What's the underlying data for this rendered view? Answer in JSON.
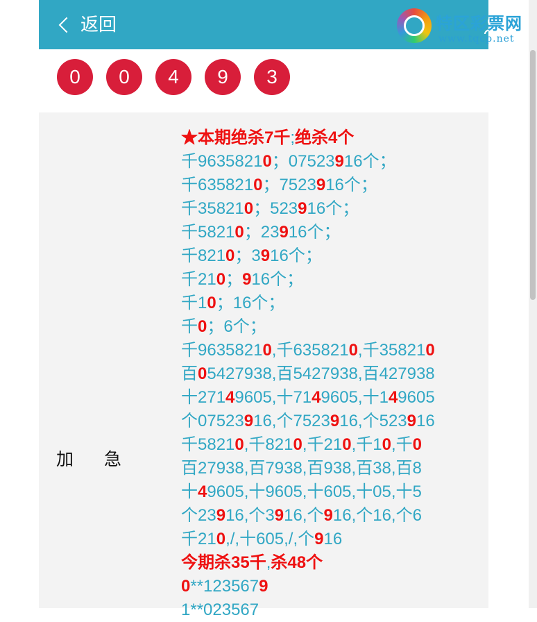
{
  "header": {
    "back_label": "返回",
    "logo_title": "特区彩票网",
    "logo_url": "www.tqcp.net"
  },
  "balls": [
    "0",
    "0",
    "4",
    "9",
    "3"
  ],
  "colors": {
    "header": "#31a7c4",
    "ball": "#d81e3a",
    "highlight": "#ee1111",
    "text": "#31a7c4"
  },
  "panel": {
    "label_1": "加",
    "label_2": "急",
    "lines": [
      [
        [
          "★本期绝杀7千",
          "r"
        ],
        [
          ";",
          ""
        ],
        [
          "绝杀4个",
          "r"
        ]
      ],
      [
        [
          "千9635821",
          ""
        ],
        [
          "0",
          "r"
        ],
        [
          "；07523",
          ""
        ],
        [
          "9",
          "r"
        ],
        [
          "16个；",
          ""
        ]
      ],
      [
        [
          "千635821",
          ""
        ],
        [
          "0",
          "r"
        ],
        [
          "；7523",
          ""
        ],
        [
          "9",
          "r"
        ],
        [
          "16个；",
          ""
        ]
      ],
      [
        [
          "千35821",
          ""
        ],
        [
          "0",
          "r"
        ],
        [
          "；523",
          ""
        ],
        [
          "9",
          "r"
        ],
        [
          "16个；",
          ""
        ]
      ],
      [
        [
          "千5821",
          ""
        ],
        [
          "0",
          "r"
        ],
        [
          "；23",
          ""
        ],
        [
          "9",
          "r"
        ],
        [
          "16个；",
          ""
        ]
      ],
      [
        [
          "千821",
          ""
        ],
        [
          "0",
          "r"
        ],
        [
          "；3",
          ""
        ],
        [
          "9",
          "r"
        ],
        [
          "16个；",
          ""
        ]
      ],
      [
        [
          "千21",
          ""
        ],
        [
          "0",
          "r"
        ],
        [
          "；",
          ""
        ],
        [
          "9",
          "r"
        ],
        [
          "16个；",
          ""
        ]
      ],
      [
        [
          "千1",
          ""
        ],
        [
          "0",
          "r"
        ],
        [
          "；16个；",
          ""
        ]
      ],
      [
        [
          "千",
          ""
        ],
        [
          "0",
          "r"
        ],
        [
          "；6个；",
          ""
        ]
      ],
      [
        [
          "千9635821",
          ""
        ],
        [
          "0",
          "r"
        ],
        [
          ",千635821",
          ""
        ],
        [
          "0",
          "r"
        ],
        [
          ",千35821",
          ""
        ],
        [
          "0",
          "r"
        ]
      ],
      [
        [
          "百",
          ""
        ],
        [
          "0",
          "r"
        ],
        [
          "5427938,百5427938,百427938",
          ""
        ]
      ],
      [
        [
          "十271",
          ""
        ],
        [
          "4",
          "r"
        ],
        [
          "9605,十71",
          ""
        ],
        [
          "4",
          "r"
        ],
        [
          "9605,十1",
          ""
        ],
        [
          "4",
          "r"
        ],
        [
          "9605",
          ""
        ]
      ],
      [
        [
          "个07523",
          ""
        ],
        [
          "9",
          "r"
        ],
        [
          "16,个7523",
          ""
        ],
        [
          "9",
          "r"
        ],
        [
          "16,个523",
          ""
        ],
        [
          "9",
          "r"
        ],
        [
          "16",
          ""
        ]
      ],
      [
        [
          "千5821",
          ""
        ],
        [
          "0",
          "r"
        ],
        [
          ",千821",
          ""
        ],
        [
          "0",
          "r"
        ],
        [
          ",千21",
          ""
        ],
        [
          "0",
          "r"
        ],
        [
          ",千1",
          ""
        ],
        [
          "0",
          "r"
        ],
        [
          ",千",
          ""
        ],
        [
          "0",
          "r"
        ]
      ],
      [
        [
          "百27938,百7938,百938,百38,百8",
          ""
        ]
      ],
      [
        [
          "十",
          ""
        ],
        [
          "4",
          "r"
        ],
        [
          "9605,十9605,十605,十05,十5",
          ""
        ]
      ],
      [
        [
          "个23",
          ""
        ],
        [
          "9",
          "r"
        ],
        [
          "16,个3",
          ""
        ],
        [
          "9",
          "r"
        ],
        [
          "16,个",
          ""
        ],
        [
          "9",
          "r"
        ],
        [
          "16,个16,个6",
          ""
        ]
      ],
      [
        [
          "千21",
          ""
        ],
        [
          "0",
          "r"
        ],
        [
          ",/,十605,/,个",
          ""
        ],
        [
          "9",
          "r"
        ],
        [
          "16",
          ""
        ]
      ],
      [
        [
          "今期杀35千",
          "r"
        ],
        [
          ",",
          ""
        ],
        [
          "杀48个",
          "r"
        ]
      ],
      [
        [
          "0",
          "r"
        ],
        [
          "**123567",
          ""
        ],
        [
          "9",
          "r"
        ]
      ],
      [
        [
          "1**023567",
          ""
        ]
      ]
    ]
  }
}
